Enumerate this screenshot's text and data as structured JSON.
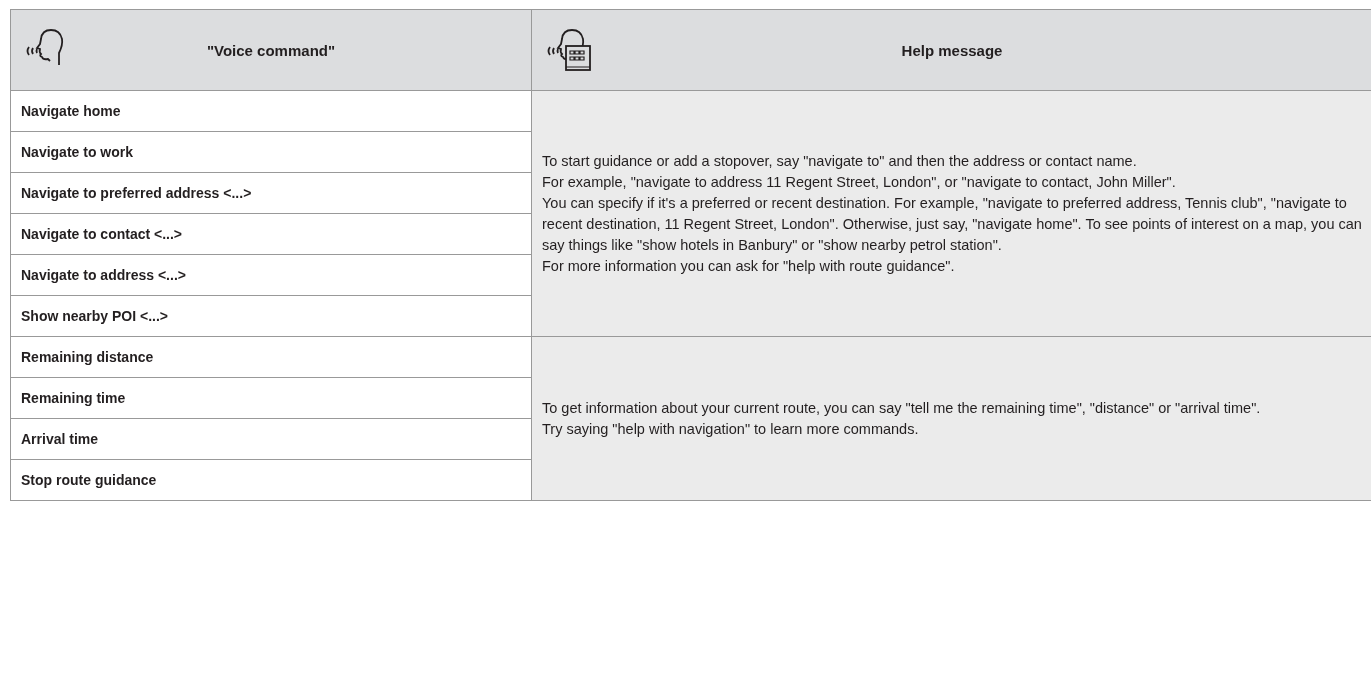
{
  "header": {
    "command_label": "\"Voice command\"",
    "help_label": "Help message"
  },
  "groups": [
    {
      "commands": [
        "Navigate home",
        "Navigate to work",
        "Navigate to preferred address <...>",
        "Navigate to contact <...>",
        "Navigate to address <...>",
        "Show nearby POI <...>"
      ],
      "help": [
        "To start guidance or add a stopover, say \"navigate to\" and then the address or contact name.",
        "For example, \"navigate to address 11 Regent Street, London\", or \"navigate to contact, John Miller\".",
        "You can specify if it's a preferred or recent destination. For example, \"navigate to preferred address, Tennis club\", \"navigate to recent destination, 11 Regent Street, London\". Otherwise, just say, \"navigate home\". To see points of interest on a map, you can say things like \"show hotels in Banbury\" or \"show nearby petrol station\".",
        "For more information you can ask for \"help with route guidance\"."
      ]
    },
    {
      "commands": [
        "Remaining distance",
        "Remaining time",
        "Arrival time",
        "Stop route guidance"
      ],
      "help": [
        "To get information about your current route, you can say \"tell me the remaining time\", \"distance\" or \"arrival time\".",
        "Try saying \"help with navigation\" to learn more commands."
      ]
    }
  ]
}
